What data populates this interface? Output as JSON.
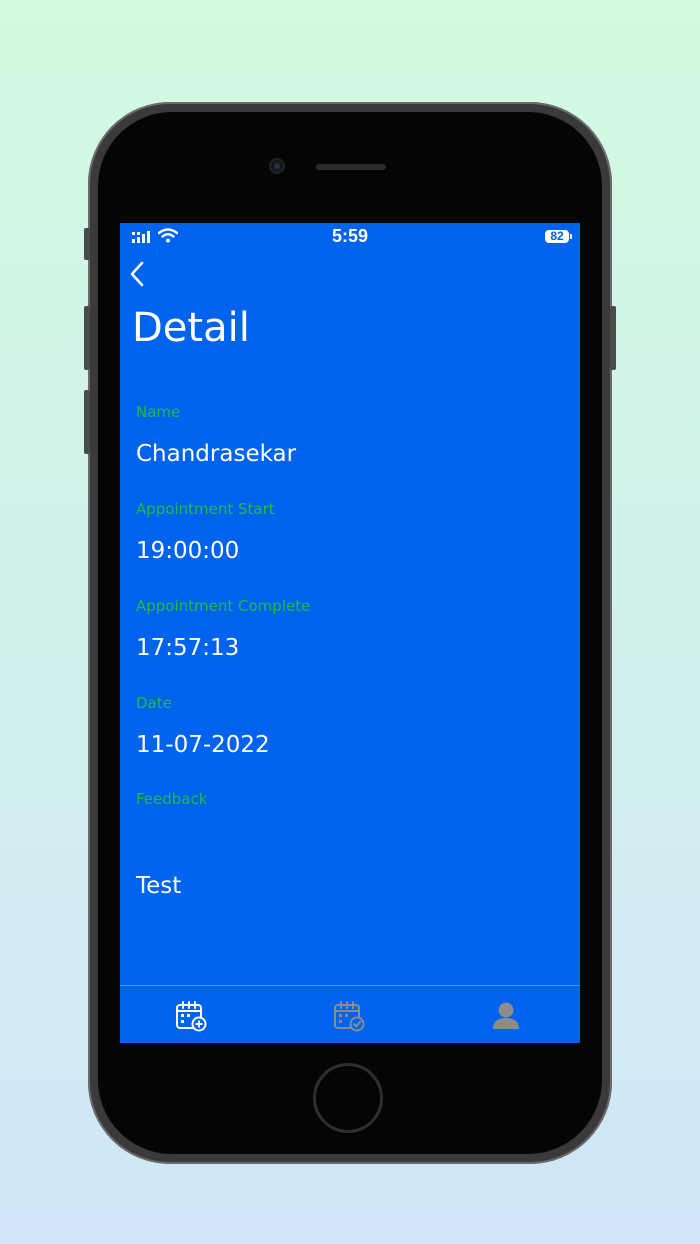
{
  "status_bar": {
    "time": "5:59",
    "battery": "82"
  },
  "header": {
    "back_icon": "chevron-left-icon",
    "title": "Detail"
  },
  "fields": [
    {
      "label": "Name",
      "value": "Chandrasekar"
    },
    {
      "label": "Appointment Start",
      "value": "19:00:00"
    },
    {
      "label": "Appointment Complete",
      "value": "17:57:13"
    },
    {
      "label": "Date",
      "value": "11-07-2022"
    },
    {
      "label": "Feedback",
      "value": "Test"
    }
  ],
  "tab_bar": {
    "items": [
      {
        "icon": "calendar-add-icon",
        "active": true
      },
      {
        "icon": "calendar-check-icon",
        "active": false
      },
      {
        "icon": "profile-icon",
        "active": false
      }
    ]
  },
  "colors": {
    "screen_bg": "#0063ee",
    "label": "#26b848",
    "value": "#ffffff",
    "tab_active": "#ffffff",
    "tab_inactive": "#8c8c8c",
    "tab_divider": "#1eb2b2"
  }
}
